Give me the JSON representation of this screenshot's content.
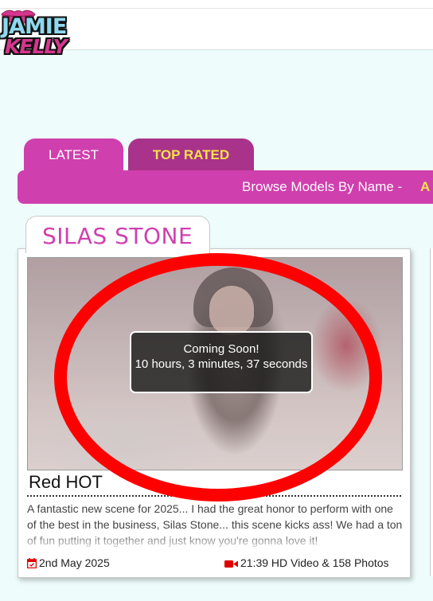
{
  "header": {
    "logo_line1": "JAMIE",
    "logo_line2": "KELLY"
  },
  "tabs": [
    {
      "label": "LATEST"
    },
    {
      "label": "TOP RATED"
    }
  ],
  "browse": {
    "label": "Browse Models By Name -",
    "letter": "A"
  },
  "model": {
    "name": "SILAS STONE"
  },
  "scene": {
    "overlay_line1": "Coming Soon!",
    "overlay_line2": "10 hours, 3 minutes, 37 seconds",
    "title": "Red HOT",
    "description": "A fantastic new scene for 2025... I had the great honor to perform with one of the best in the business, Silas Stone... this scene kicks ass! We had a ton of fun putting it together and just know you're gonna love it!",
    "date": "2nd May 2025",
    "media": "21:39 HD Video & 158 Photos"
  },
  "colors": {
    "accent": "#cf3fad",
    "accent_dark": "#a9338a",
    "highlight": "#f7e24a",
    "annotation": "#ff0000"
  },
  "icons": {
    "calendar": "calendar-icon",
    "video": "video-camera-icon"
  }
}
